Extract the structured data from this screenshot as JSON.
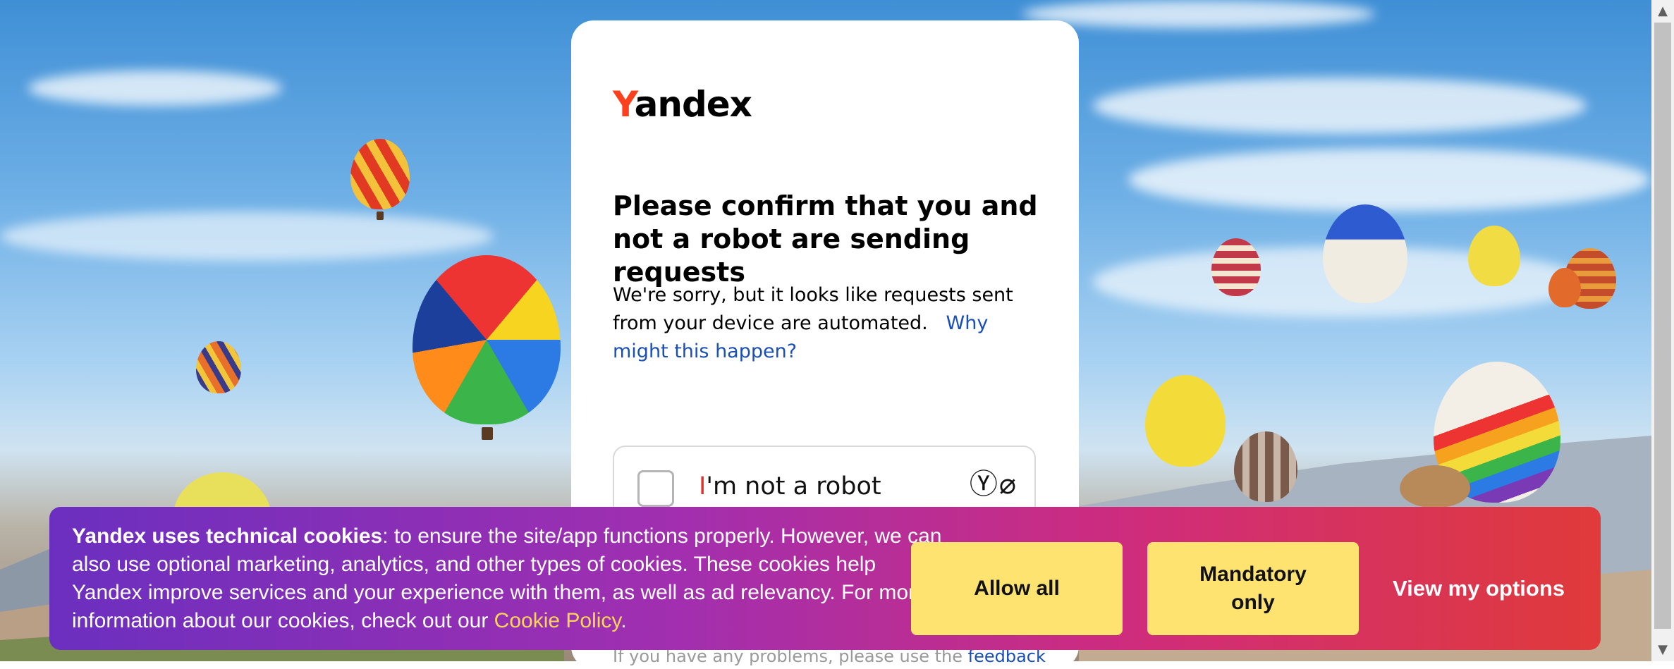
{
  "captcha": {
    "logo": {
      "first_letter": "Y",
      "rest": "andex"
    },
    "title": "Please confirm that you and not a robot are sending requests",
    "description": "We're sorry, but it looks like requests sent from your device are automated.",
    "why_link": "Why might this happen?",
    "checkbox_label_first": "I",
    "checkbox_label_rest": "'m not a robot",
    "icons": [
      "yandex-circle-icon",
      "leaf-circle-icon"
    ],
    "feedback_text": "If you have any problems, please use the",
    "feedback_link": "feedback"
  },
  "cookie_banner": {
    "bold_text": "Yandex uses technical cookies",
    "text": ": to ensure the site/app functions properly. However, we can also use optional marketing, analytics, and other types of cookies. These cookies help Yandex improve services and your experience with them, as well as ad relevancy. For more information about our cookies, check out our ",
    "policy_link": "Cookie Policy",
    "end": ".",
    "buttons": {
      "allow_all": "Allow all",
      "mandatory_only": "Mandatory only",
      "view_options": "View my options"
    }
  },
  "colors": {
    "brand_red": "#fc3f1d",
    "link_blue": "#1a4fb8",
    "button_yellow": "#fee371",
    "cookie_link": "#ffd659"
  }
}
